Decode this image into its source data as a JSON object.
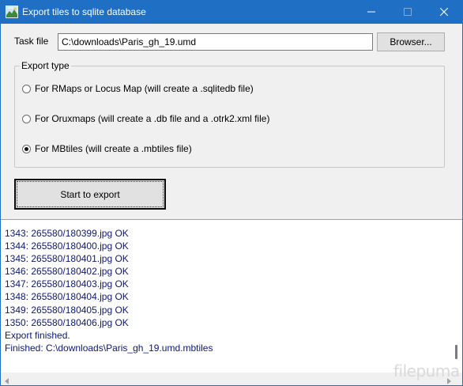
{
  "window": {
    "title": "Export tiles to sqlite database",
    "icons": {
      "app": "map-tiles-icon",
      "minimize": "minimize-icon",
      "maximize": "maximize-icon",
      "close": "close-icon"
    },
    "colors": {
      "titlebar": "#1f6fc5",
      "log_text": "#0d1873"
    }
  },
  "task": {
    "label": "Task file",
    "value": "C:\\downloads\\Paris_gh_19.umd",
    "browse_label": "Browser..."
  },
  "export_type": {
    "legend": "Export type",
    "options": [
      {
        "label": "For RMaps or Locus Map   (will create a .sqlitedb file)",
        "checked": false
      },
      {
        "label": "For Oruxmaps   (will create a .db file and a .otrk2.xml file)",
        "checked": false
      },
      {
        "label": "For MBtiles   (will create a .mbtiles file)",
        "checked": true
      }
    ]
  },
  "actions": {
    "start_label": "Start to export"
  },
  "log": {
    "lines": [
      "1343: 265580/180399.jpg OK",
      "1344: 265580/180400.jpg OK",
      "1345: 265580/180401.jpg OK",
      "1346: 265580/180402.jpg OK",
      "1347: 265580/180403.jpg OK",
      "1348: 265580/180404.jpg OK",
      "1349: 265580/180405.jpg OK",
      "1350: 265580/180406.jpg OK",
      "Export finished.",
      "Finished: C:\\downloads\\Paris_gh_19.umd.mbtiles"
    ]
  },
  "watermark": "filepuma"
}
